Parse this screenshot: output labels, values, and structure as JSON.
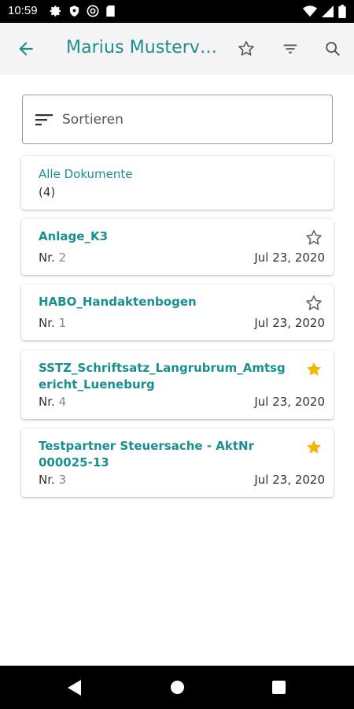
{
  "status_bar": {
    "time": "10:59",
    "left_icons": [
      "settings-icon",
      "shield-icon",
      "at-icon",
      "sd-card-icon"
    ],
    "right_icons": [
      "wifi-icon",
      "cell-signal-icon",
      "battery-icon"
    ]
  },
  "app_bar": {
    "title": "Marius Musterv…",
    "actions": [
      "star-outline-icon",
      "filter-icon",
      "search-icon"
    ]
  },
  "sort": {
    "label": "Sortieren"
  },
  "all_documents": {
    "label": "Alle Dokumente",
    "count": "(4)"
  },
  "documents": [
    {
      "name": "Anlage_K3",
      "nr_label": "Nr.",
      "nr": "2",
      "date": "Jul 23, 2020",
      "starred": false
    },
    {
      "name": "HABO_Handaktenbogen",
      "nr_label": "Nr.",
      "nr": "1",
      "date": "Jul 23, 2020",
      "starred": false
    },
    {
      "name": "SSTZ_Schriftsatz_Langrubrum_Amtsgericht_Lueneburg",
      "nr_label": "Nr.",
      "nr": "4",
      "date": "Jul 23, 2020",
      "starred": true
    },
    {
      "name": "Testpartner Steuersache - AktNr 000025-13",
      "nr_label": "Nr.",
      "nr": "3",
      "date": "Jul 23, 2020",
      "starred": true
    }
  ],
  "colors": {
    "accent": "#1a8f8f",
    "star_filled": "#f5b400",
    "star_outline": "#666666",
    "app_bar_bg": "#f4f4f4"
  }
}
